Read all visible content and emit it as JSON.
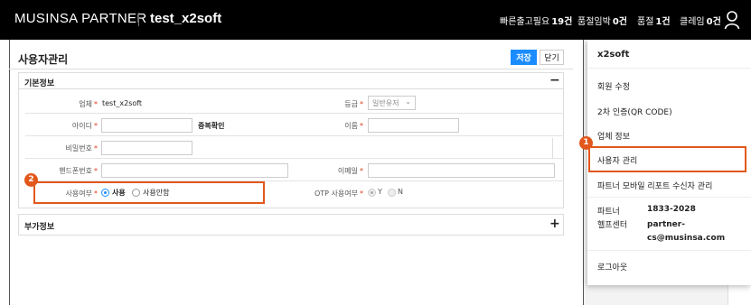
{
  "topbar": {
    "brand": "MUSINSA PARTNER",
    "account": "test_x2soft",
    "stats": [
      {
        "label": "빠른출고필요",
        "count": "19건"
      },
      {
        "label": "품절임박",
        "count": "0건"
      },
      {
        "label": "품절",
        "count": "1건"
      },
      {
        "label": "클레임",
        "count": "0건"
      }
    ]
  },
  "page": {
    "title": "사용자관리",
    "save_label": "저장",
    "close_label": "닫기"
  },
  "basic": {
    "title": "기본정보",
    "toggle": "−",
    "fields": {
      "company_label": "업체",
      "company_value": "test_x2soft",
      "grade_label": "등급",
      "grade_value": "일반유저",
      "id_label": "아이디",
      "dup_check": "중복확인",
      "name_label": "이름",
      "password_label": "비밀번호",
      "phone_label": "핸드폰번호",
      "email_label": "이메일",
      "use_label": "사용여부",
      "use_on": "사용",
      "use_off": "사용안함",
      "otp_label": "OTP 사용여부",
      "otp_y": "Y",
      "otp_n": "N",
      "required_mark": "*"
    }
  },
  "extra": {
    "title": "부가정보",
    "toggle": "+"
  },
  "steps": {
    "one": "1",
    "two": "2"
  },
  "menu": {
    "user": "x2soft",
    "items": [
      "회원 수정",
      "2차 인증(QR CODE)",
      "업체 정보",
      "사용자 관리",
      "파트너 모바일 리포트 수신자 관리"
    ],
    "help_label_1": "파트너",
    "help_label_2": "헬프센터",
    "help_phone": "1833-2028",
    "help_email_1": "partner-",
    "help_email_2": "cs@musinsa.com",
    "logout": "로그아웃"
  },
  "colors": {
    "accent": "#1a8cff",
    "highlight": "#e2571c",
    "required": "#e03a1c",
    "topbar": "#000000"
  }
}
